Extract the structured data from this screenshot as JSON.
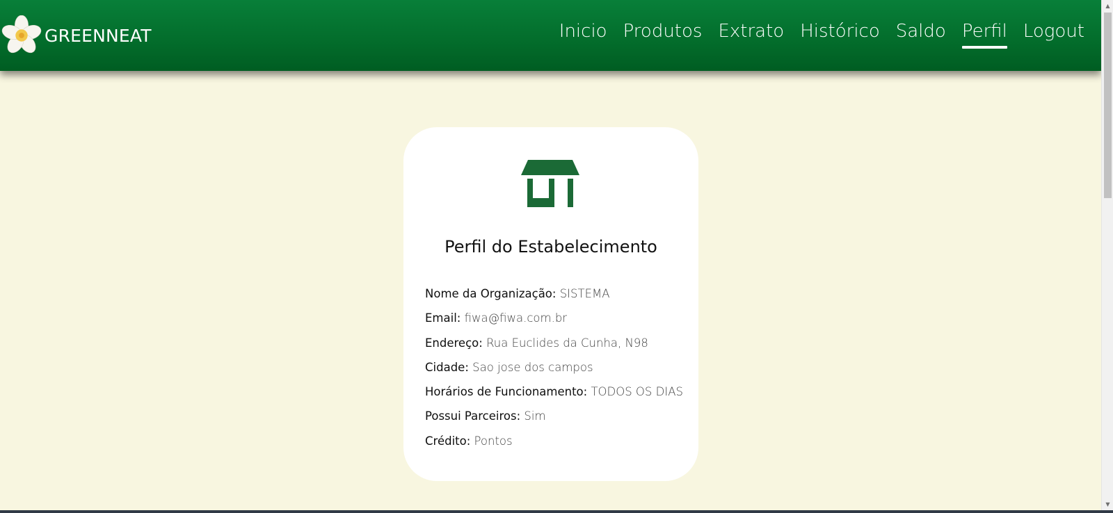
{
  "brand": {
    "name": "GREENNEAT",
    "logo_icon": "plumeria-flower-icon"
  },
  "nav": {
    "items": [
      {
        "label": "Inicio"
      },
      {
        "label": "Produtos"
      },
      {
        "label": "Extrato"
      },
      {
        "label": "Histórico"
      },
      {
        "label": "Saldo"
      },
      {
        "label": "Perfil",
        "active": true
      },
      {
        "label": "Logout"
      }
    ]
  },
  "profile": {
    "icon": "store-icon",
    "title": "Perfil do Estabelecimento",
    "fields": [
      {
        "label": "Nome da Organização:",
        "value": "SISTEMA"
      },
      {
        "label": "Email:",
        "value": "fiwa@fiwa.com.br"
      },
      {
        "label": "Endereço:",
        "value": "Rua Euclides da Cunha, N98"
      },
      {
        "label": "Cidade:",
        "value": "Sao jose dos campos"
      },
      {
        "label": "Horários de Funcionamento:",
        "value": "TODOS OS DIAS"
      },
      {
        "label": "Possui Parceiros:",
        "value": "Sim"
      },
      {
        "label": "Crédito:",
        "value": "Pontos"
      }
    ]
  },
  "colors": {
    "header_green": "#036e2c",
    "page_background": "#f8f6e0",
    "icon_green": "#1b6a36",
    "card_background": "#ffffff"
  }
}
